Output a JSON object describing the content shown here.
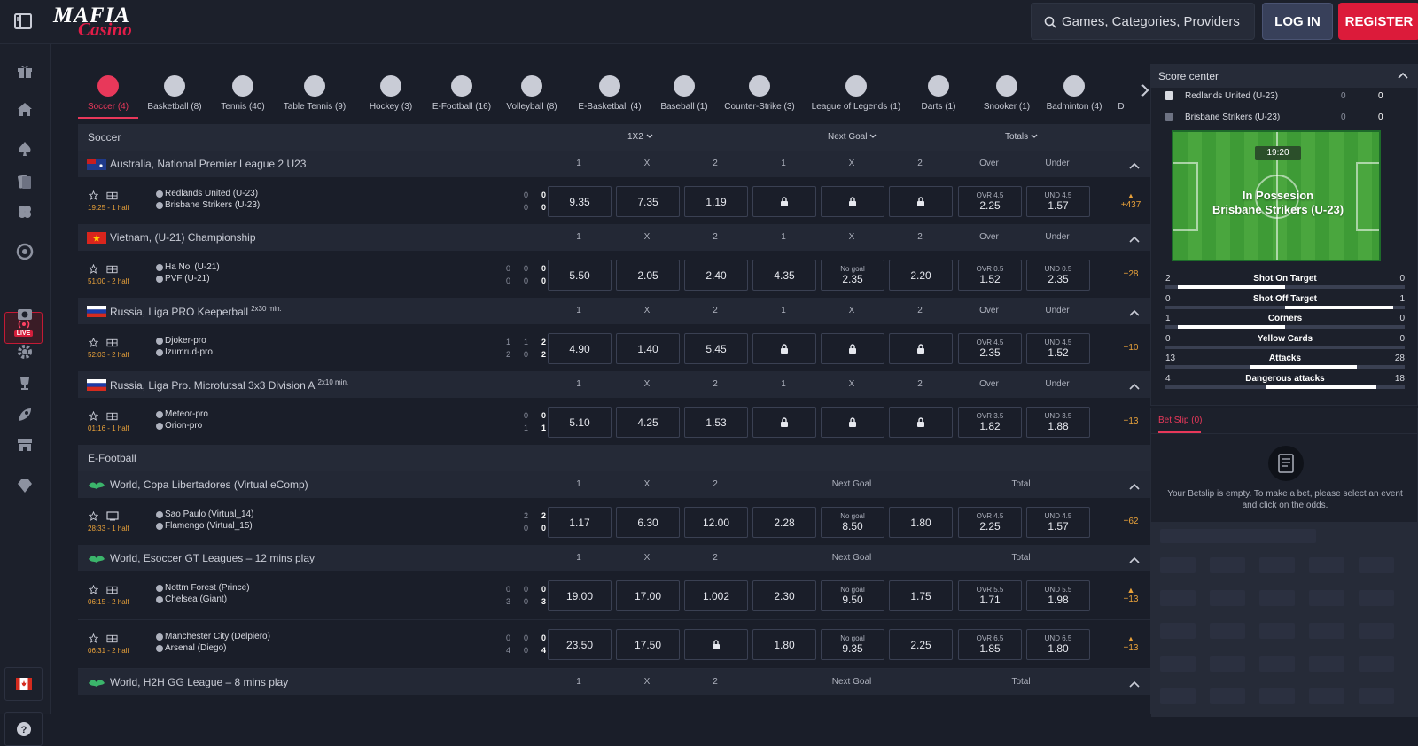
{
  "header": {
    "logo_top": "MAFIA",
    "logo_bottom": "Casino",
    "search_placeholder": "Games, Categories, Providers",
    "login": "LOG IN",
    "register": "REGISTER"
  },
  "sidebar": {
    "live_badge": "LIVE",
    "icons": [
      "gift-icon",
      "home-icon",
      "spade-icon",
      "cards-icon",
      "clover-icon",
      "roulette-icon",
      "live-icon",
      "casino-chip-icon",
      "cog-icon",
      "trophy-icon",
      "rocket-icon",
      "store-icon",
      "diamond-icon"
    ]
  },
  "sport_tabs": [
    {
      "label": "Soccer (4)",
      "active": true
    },
    {
      "label": "Basketball (8)"
    },
    {
      "label": "Tennis (40)"
    },
    {
      "label": "Table Tennis (9)"
    },
    {
      "label": "Hockey (3)"
    },
    {
      "label": "E-Football (16)"
    },
    {
      "label": "Volleyball (8)"
    },
    {
      "label": "E-Basketball (4)"
    },
    {
      "label": "Baseball (1)"
    },
    {
      "label": "Counter-Strike (3)"
    },
    {
      "label": "League of Legends (1)"
    },
    {
      "label": "Darts (1)"
    },
    {
      "label": "Snooker (1)"
    },
    {
      "label": "Badminton (4)"
    },
    {
      "label": "D"
    }
  ],
  "soccer_header": {
    "title": "Soccer",
    "dd1": "1X2",
    "dd2": "Next Goal",
    "dd3": "Totals"
  },
  "efootball_header": {
    "title": "E-Football"
  },
  "cols": {
    "c1": "1",
    "cx": "X",
    "c2": "2",
    "over": "Over",
    "under": "Under",
    "next_goal": "Next Goal",
    "total": "Total"
  },
  "leagues": [
    {
      "name": "Australia, National Premier League 2 U23",
      "sup": "",
      "t1": "Redlands United (U-23)",
      "t2": "Brisbane Strikers (U-23)",
      "time": "19:25 - 1 half",
      "s1": [
        "0",
        "0"
      ],
      "s2": [
        "0",
        "0"
      ],
      "o1": "9.35",
      "ox": "7.35",
      "o2": "1.19",
      "ovr": "OVR 4.5",
      "ovrv": "2.25",
      "und": "UND 4.5",
      "undv": "1.57",
      "more": "+437"
    },
    {
      "name": "Vietnam, (U-21) Championship",
      "sup": "",
      "t1": "Ha Noi (U-21)",
      "t2": "PVF (U-21)",
      "time": "51:00 - 2 half",
      "s1": [
        "0",
        "0",
        "0"
      ],
      "s2": [
        "0",
        "0",
        "0"
      ],
      "o1": "5.50",
      "ox": "2.05",
      "o2": "2.40",
      "n1": "4.35",
      "nx_label": "No goal",
      "nx": "2.35",
      "n2": "2.20",
      "ovr": "OVR 0.5",
      "ovrv": "1.52",
      "und": "UND 0.5",
      "undv": "2.35",
      "more": "+28"
    },
    {
      "name": "Russia, Liga PRO Keeperball",
      "sup": "2x30 min.",
      "t1": "Djoker-pro",
      "t2": "Izumrud-pro",
      "time": "52:03 - 2 half",
      "s1": [
        "1",
        "1",
        "2"
      ],
      "s2": [
        "2",
        "0",
        "2"
      ],
      "o1": "4.90",
      "ox": "1.40",
      "o2": "5.45",
      "ovr": "OVR 4.5",
      "ovrv": "2.35",
      "und": "UND 4.5",
      "undv": "1.52",
      "more": "+10"
    },
    {
      "name": "Russia, Liga Pro. Microfutsal 3x3 Division A",
      "sup": "2x10 min.",
      "t1": "Meteor-pro",
      "t2": "Orion-pro",
      "time": "01:16 - 1 half",
      "s1": [
        "0",
        "0"
      ],
      "s2": [
        "1",
        "1"
      ],
      "o1": "5.10",
      "ox": "4.25",
      "o2": "1.53",
      "ovr": "OVR 3.5",
      "ovrv": "1.82",
      "und": "UND 3.5",
      "undv": "1.88",
      "more": "+13"
    }
  ],
  "eleagues": [
    {
      "name": "World, Copa Libertadores (Virtual eComp)",
      "t1": "Sao Paulo (Virtual_14)",
      "t2": "Flamengo (Virtual_15)",
      "time": "28:33 - 1 half",
      "s1": [
        "2",
        "2"
      ],
      "s2": [
        "0",
        "0"
      ],
      "o1": "1.17",
      "ox": "6.30",
      "o2": "12.00",
      "n1": "2.28",
      "nx_label": "No goal",
      "nx": "8.50",
      "n2": "1.80",
      "ovr": "OVR 4.5",
      "ovrv": "2.25",
      "und": "UND 4.5",
      "undv": "1.57",
      "more": "+62"
    },
    {
      "name": "World, Esoccer GT Leagues – 12 mins play",
      "rows": [
        {
          "t1": "Nottm Forest (Prince)",
          "t2": "Chelsea (Giant)",
          "time": "06:15 - 2 half",
          "s1": [
            "0",
            "0",
            "0"
          ],
          "s2": [
            "3",
            "0",
            "3"
          ],
          "o1": "19.00",
          "ox": "17.00",
          "o2": "1.002",
          "n1": "2.30",
          "nx_label": "No goal",
          "nx": "9.50",
          "n2": "1.75",
          "ovr": "OVR 5.5",
          "ovrv": "1.71",
          "und": "UND 5.5",
          "undv": "1.98",
          "more": "+13"
        },
        {
          "t1": "Manchester City (Delpiero)",
          "t2": "Arsenal (Diego)",
          "time": "06:31 - 2 half",
          "s1": [
            "0",
            "0",
            "0"
          ],
          "s2": [
            "4",
            "0",
            "4"
          ],
          "o1": "23.50",
          "ox": "17.50",
          "n1": "1.80",
          "nx_label": "No goal",
          "nx": "9.35",
          "n2": "2.25",
          "ovr": "OVR 6.5",
          "ovrv": "1.85",
          "und": "UND 6.5",
          "undv": "1.80",
          "more": "+13"
        }
      ]
    },
    {
      "name": "World, H2H GG League – 8 mins play"
    }
  ],
  "score_center": {
    "title": "Score center",
    "team1": "Redlands United (U-23)",
    "team2": "Brisbane Strikers (U-23)",
    "t1s": [
      "0",
      "0"
    ],
    "t2s": [
      "0",
      "0"
    ],
    "clock": "19:20",
    "possession_line1": "In Possesion",
    "possession_line2": "Brisbane Strikers (U-23)",
    "stats": [
      {
        "name": "Shot On Target",
        "l": "2",
        "r": "0",
        "lf": 0.45,
        "rf": 0
      },
      {
        "name": "Shot Off Target",
        "l": "0",
        "r": "1",
        "lf": 0,
        "rf": 0.45
      },
      {
        "name": "Corners",
        "l": "1",
        "r": "0",
        "lf": 0.45,
        "rf": 0
      },
      {
        "name": "Yellow Cards",
        "l": "0",
        "r": "0",
        "lf": 0,
        "rf": 0
      },
      {
        "name": "Attacks",
        "l": "13",
        "r": "28",
        "lf": 0.15,
        "rf": 0.3
      },
      {
        "name": "Dangerous attacks",
        "l": "4",
        "r": "18",
        "lf": 0.08,
        "rf": 0.38
      }
    ]
  },
  "betslip": {
    "tab": "Bet Slip (0)",
    "empty": "Your Betslip is empty. To make a bet, please select an event and click on the odds."
  },
  "colors": {
    "accent": "#e8385a",
    "bg": "#1a1e29",
    "odds_more": "#e8a13a"
  }
}
